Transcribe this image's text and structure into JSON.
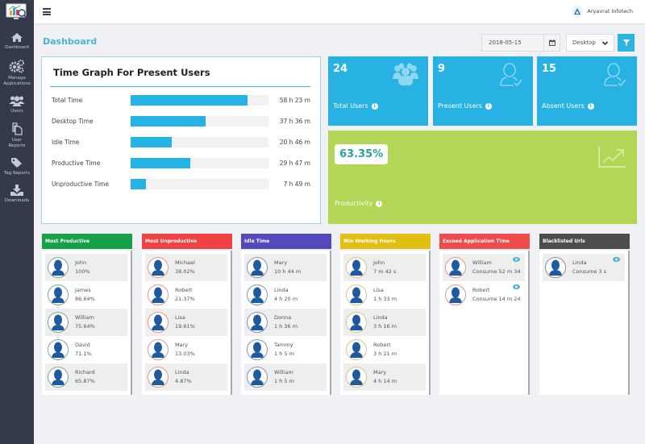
{
  "app": {
    "brand_name": "Aryavrat Infotech"
  },
  "sidebar": {
    "items": [
      {
        "label": "Dashboard",
        "icon": "home-icon"
      },
      {
        "label": "Manage Applications",
        "icon": "gears-icon"
      },
      {
        "label": "Users",
        "icon": "users-icon"
      },
      {
        "label": "User Reports",
        "icon": "copy-icon"
      },
      {
        "label": "Tag Reports",
        "icon": "tags-icon"
      },
      {
        "label": "Downloads",
        "icon": "download-icon"
      }
    ]
  },
  "header": {
    "title": "Dashboard",
    "date_value": "2018-05-15",
    "device_select": "Desktop"
  },
  "time_graph": {
    "title": "Time Graph For Present Users",
    "rows": [
      {
        "label": "Total Time",
        "value": "58 h 23 m",
        "fill": 0.85
      },
      {
        "label": "Desktop Time",
        "value": "37 h 36 m",
        "fill": 0.545
      },
      {
        "label": "Idle Time",
        "value": "20 h 46 m",
        "fill": 0.3
      },
      {
        "label": "Productive Time",
        "value": "29 h 47 m",
        "fill": 0.43
      },
      {
        "label": "Unproductive Time",
        "value": "7 h 49 m",
        "fill": 0.11
      }
    ]
  },
  "stats": {
    "total_users": {
      "value": "24",
      "label": "Total Users"
    },
    "present_users": {
      "value": "9",
      "label": "Present Users"
    },
    "absent_users": {
      "value": "15",
      "label": "Absent Users"
    },
    "productivity": {
      "value": "63.35%",
      "label": "Productivity"
    }
  },
  "panels": [
    {
      "title": "Most Productive",
      "color": "#16a047",
      "ring": "#7aaa8e",
      "items": [
        {
          "name": "John",
          "value": "100%"
        },
        {
          "name": "James",
          "value": "86.64%"
        },
        {
          "name": "William",
          "value": "75.64%"
        },
        {
          "name": "David",
          "value": "71.1%"
        },
        {
          "name": "Richard",
          "value": "65.87%"
        }
      ]
    },
    {
      "title": "Most Unproductive",
      "color": "#f04242",
      "ring": "#d99a8e",
      "items": [
        {
          "name": "Michael",
          "value": "38.02%"
        },
        {
          "name": "Robert",
          "value": "21.37%"
        },
        {
          "name": "Lisa",
          "value": "19.61%"
        },
        {
          "name": "Mary",
          "value": "13.03%"
        },
        {
          "name": "Linda",
          "value": "4.87%"
        }
      ]
    },
    {
      "title": "Idle Time",
      "color": "#5448bd",
      "ring": "#8a90b8",
      "items": [
        {
          "name": "Mary",
          "value": "10 h 44 m"
        },
        {
          "name": "Linda",
          "value": "4 h 20 m"
        },
        {
          "name": "Donna",
          "value": "1 h 36 m"
        },
        {
          "name": "Tammy",
          "value": "1 h 5 m"
        },
        {
          "name": "William",
          "value": "1 h 5 m"
        }
      ]
    },
    {
      "title": "Min Working Hours",
      "color": "#e2bf12",
      "ring": "#d8c28a",
      "items": [
        {
          "name": "John",
          "value": "7 m 42 s"
        },
        {
          "name": "Lisa",
          "value": "1 h 33 m"
        },
        {
          "name": "Linda",
          "value": "3 h 16 m"
        },
        {
          "name": "Robert",
          "value": "3 h 21 m"
        },
        {
          "name": "Mary",
          "value": "4 h 14 m"
        }
      ]
    },
    {
      "title": "Exceed Application Time",
      "color": "#f04a4a",
      "ring": "#d99a8e",
      "items": [
        {
          "name": "William",
          "value": "Consume 52 m 34"
        },
        {
          "name": "Robert",
          "value": "Consume 14 m 24"
        }
      ]
    },
    {
      "title": "Blacklisted Urls",
      "color": "#4d4d4d",
      "ring": "#8a8f9a",
      "items": [
        {
          "name": "Linda",
          "value": "Consume 3 s"
        }
      ]
    }
  ]
}
